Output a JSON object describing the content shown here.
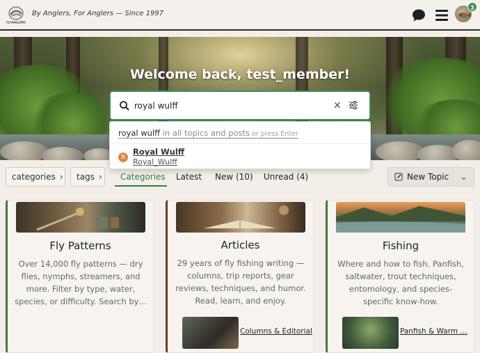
{
  "header": {
    "logo_text": "FLYANGLERS",
    "tagline": "By Anglers, For Anglers — Since 1997",
    "notification_count": "3"
  },
  "hero": {
    "welcome": "Welcome back, test_member!"
  },
  "search": {
    "value": "royal wulff",
    "dropdown": {
      "query": "royal wulff",
      "scope": " in all topics and posts",
      "hint": " or press Enter",
      "user_initial": "R",
      "user_name": "Royal Wulff",
      "user_handle": "Royal_Wulff"
    }
  },
  "nav": {
    "categories": "categories",
    "tags": "tags",
    "tabs": [
      {
        "label": "Categories",
        "active": true
      },
      {
        "label": "Latest"
      },
      {
        "label": "New (10)"
      },
      {
        "label": "Unread (4)"
      }
    ],
    "new_topic": "New Topic"
  },
  "cards": [
    {
      "title": "Fly Patterns",
      "description": "Over 14,000 fly patterns — dry flies, nymphs, streamers, and more. Filter by type, water, species, or difficulty. Search by…",
      "accent": "#3a7a3a"
    },
    {
      "title": "Articles",
      "description": "29 years of fly fishing writing — columns, trip reports, gear reviews, techniques, and humor. Read, learn, and enjoy.",
      "accent": "#6b3a1e",
      "sub": "Columns & Editorial"
    },
    {
      "title": "Fishing",
      "description": "Where and how to fish. Panfish, saltwater, trout techniques, entomology, and species-specific know-how.",
      "accent": "#3a7a3a",
      "sub": "Panfish & Warm …"
    }
  ],
  "colors": {
    "accent_green": "#2f7d4a",
    "search_border": "#3b8f5c",
    "badge": "#3a8f4c"
  }
}
